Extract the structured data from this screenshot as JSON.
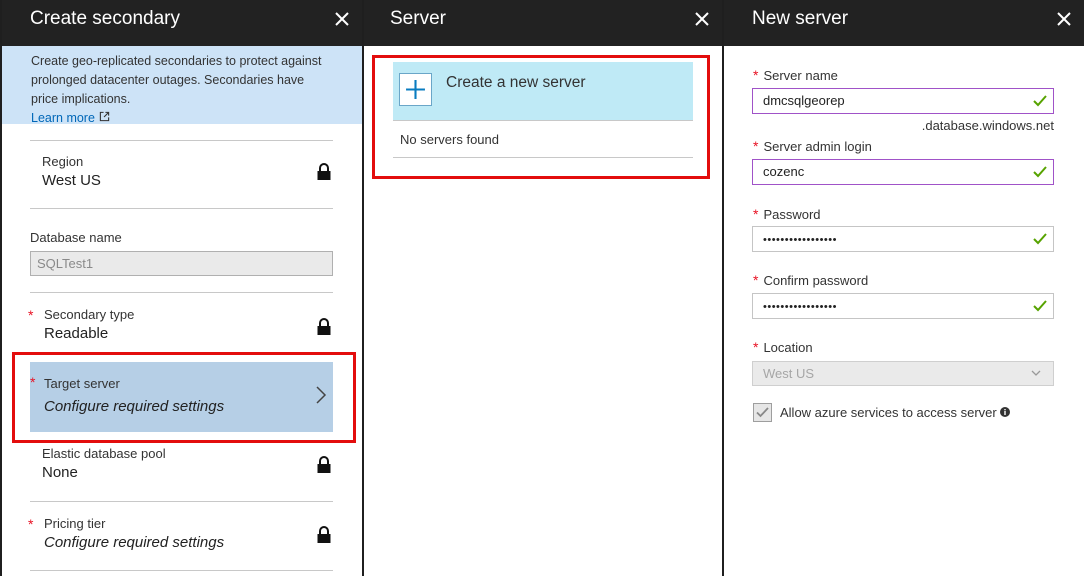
{
  "blade1": {
    "title": "Create secondary",
    "info": {
      "text": "Create geo-replicated secondaries to protect against prolonged datacenter outages. Secondaries have price implications.",
      "link": "Learn more"
    },
    "region": {
      "label": "Region",
      "value": "West US"
    },
    "database_name": {
      "label": "Database name",
      "value": "SQLTest1"
    },
    "secondary_type": {
      "label": "Secondary type",
      "value": "Readable"
    },
    "target_server": {
      "label": "Target server",
      "value": "Configure required settings"
    },
    "elastic_pool": {
      "label": "Elastic database pool",
      "value": "None"
    },
    "pricing_tier": {
      "label": "Pricing tier",
      "value": "Configure required settings"
    }
  },
  "blade2": {
    "title": "Server",
    "create_label": "Create a new server",
    "empty_text": "No servers found"
  },
  "blade3": {
    "title": "New server",
    "server_name": {
      "label": "Server name",
      "value": "dmcsqlgeorep",
      "suffix": ".database.windows.net"
    },
    "admin_login": {
      "label": "Server admin login",
      "value": "cozenc"
    },
    "password": {
      "label": "Password",
      "value": "•••••••••••••••••"
    },
    "confirm_password": {
      "label": "Confirm password",
      "value": "•••••••••••••••••"
    },
    "location": {
      "label": "Location",
      "value": "West US"
    },
    "allow_azure": {
      "label": "Allow azure services to access server",
      "checked": true
    }
  },
  "colors": {
    "header_bg": "#222222",
    "info_bg": "#cde3f7",
    "selected_bg": "#b6cfe6",
    "create_bg": "#bfeaf6",
    "highlight_red": "#e30d0d",
    "required_star": "#e81123",
    "valid_green": "#57a300",
    "valid_border": "#a052c8",
    "link": "#0067b8"
  },
  "icons": [
    "close-icon",
    "external-link-icon",
    "lock-icon",
    "chevron-right-icon",
    "plus-icon",
    "check-icon",
    "chevron-down-icon",
    "checkbox-check-icon",
    "info-icon"
  ]
}
